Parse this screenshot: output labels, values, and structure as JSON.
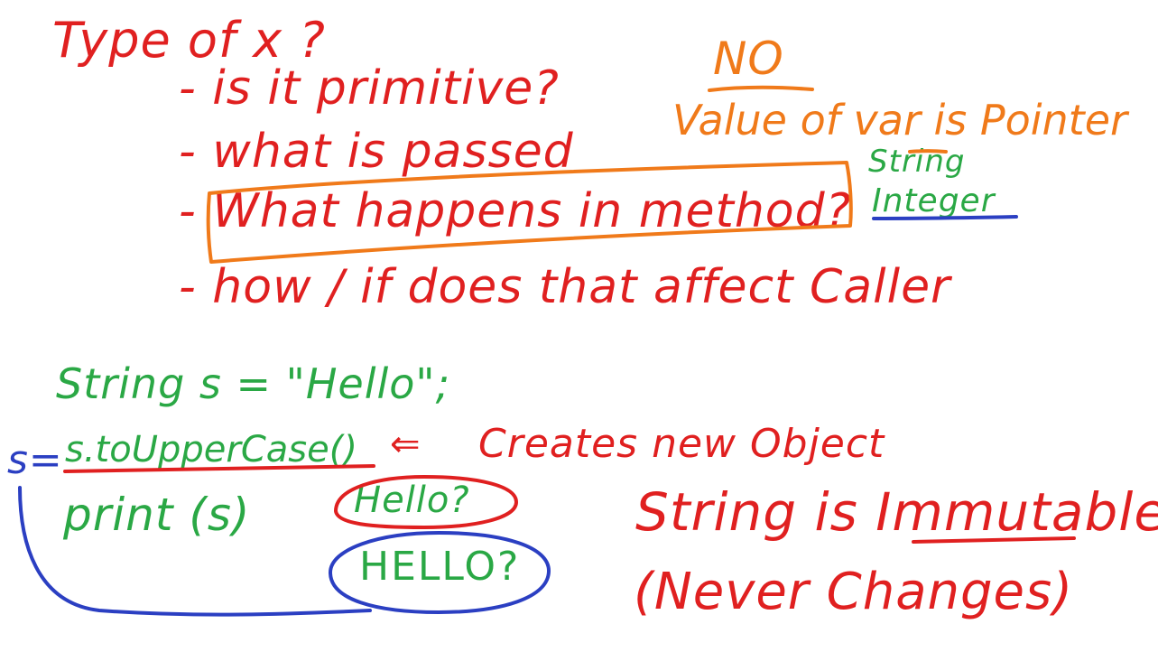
{
  "notes": {
    "title": "Type of x ?",
    "questions": [
      "- is it primitive?",
      "- what is passed",
      "- What happens in method?",
      "- how / if does that affect Caller"
    ],
    "answer_no": "NO",
    "answer_value": "Value of var is Pointer",
    "types": [
      "String",
      "Integer"
    ],
    "code_decl": "String s = \"Hello\";",
    "code_assign_lhs": "s=",
    "code_assign_rhs": "s.toUpperCase()",
    "code_arrow": "⇐",
    "code_comment": "Creates new Object",
    "code_print": "print (s)",
    "option_a": "Hello?",
    "option_b": "HELLO?",
    "conclusion": "String is Immutable",
    "conclusion_note": "(Never Changes)"
  },
  "colors": {
    "red": "#e02020",
    "orange": "#f07a1a",
    "green": "#2aa845",
    "blue": "#2b3fc2"
  }
}
